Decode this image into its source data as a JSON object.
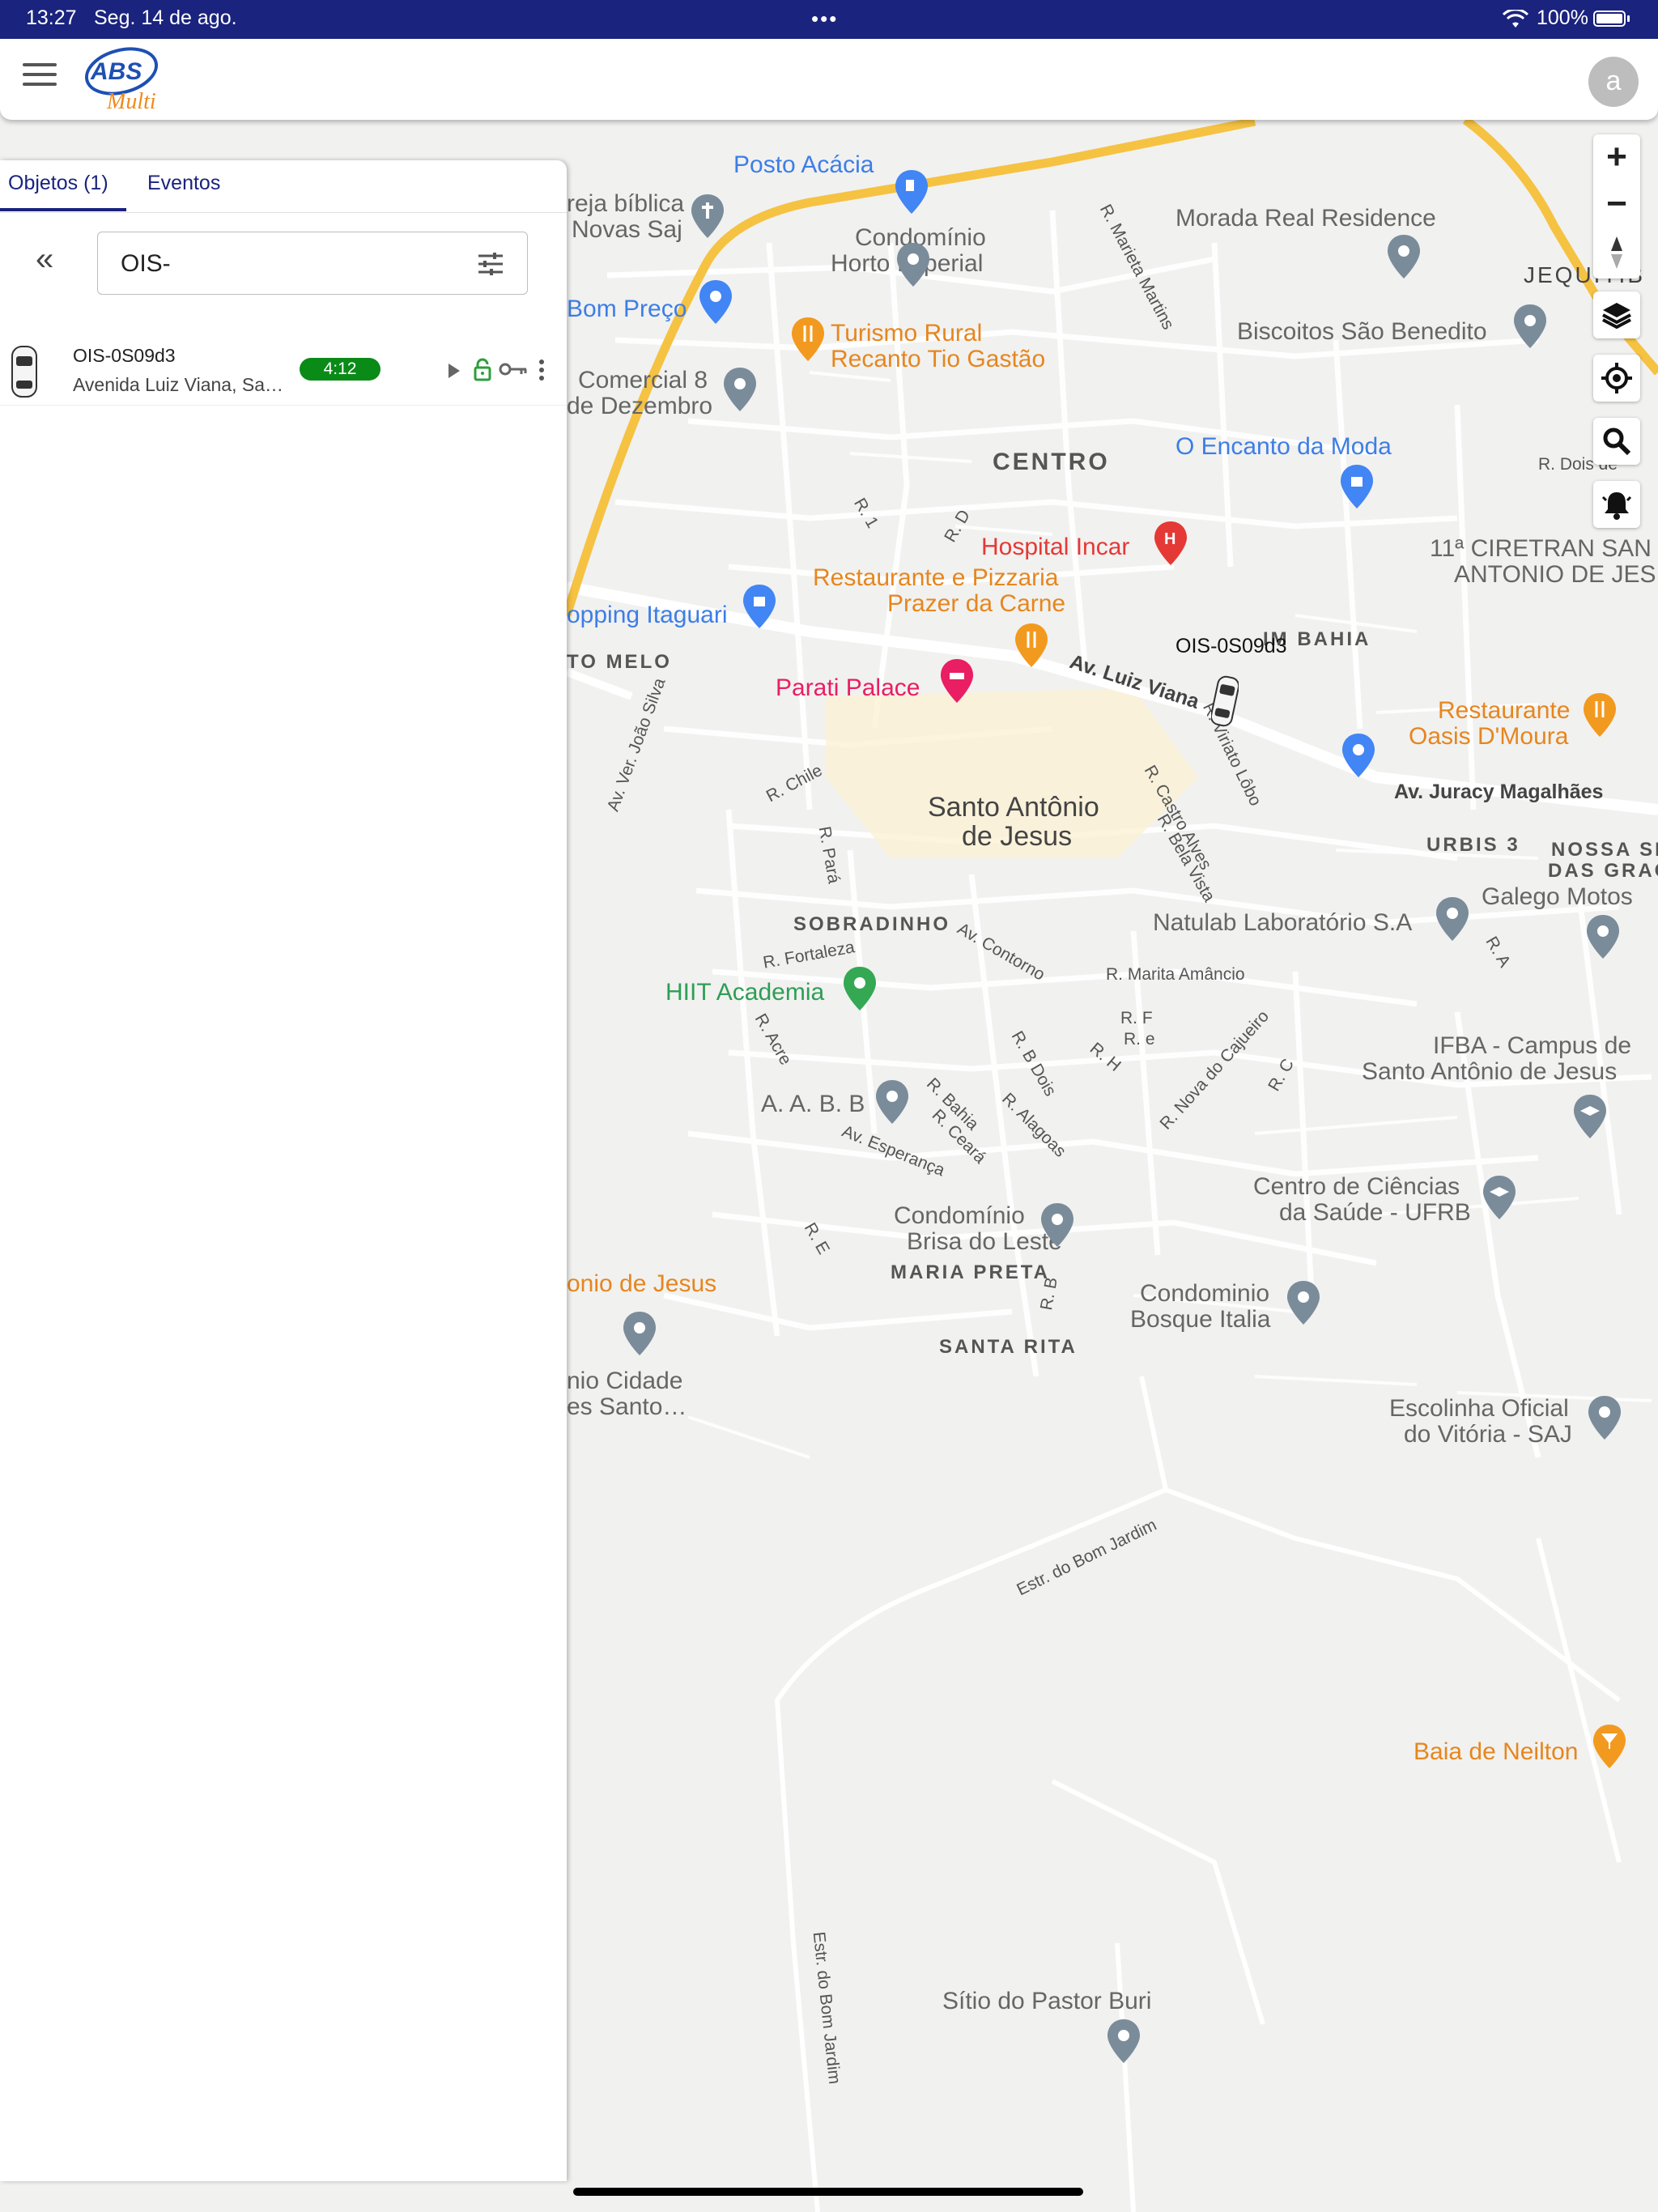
{
  "status_bar": {
    "time": "13:27",
    "date": "Seg. 14 de ago.",
    "dots": "•••",
    "battery": "100%"
  },
  "header": {
    "logo_text_top": "ABS",
    "logo_text_bottom": "Multi",
    "avatar_letter": "a"
  },
  "panel": {
    "tabs": [
      {
        "label": "Objetos (1)",
        "active": true
      },
      {
        "label": "Eventos",
        "active": false
      }
    ],
    "collapse_glyph": "«",
    "search": {
      "value": "OIS-"
    },
    "vehicles": [
      {
        "name": "OIS-0S09d3",
        "address": "Avenida Luiz Viana, Sa…",
        "badge": "4:12",
        "badge_color": "#0a8a17"
      }
    ]
  },
  "map": {
    "vehicle_label": "OIS-0S09d3",
    "controls": {
      "zoom_in": "+",
      "zoom_out": "−",
      "compass": "compass-icon",
      "layers": "layers-icon",
      "locate": "locate-icon",
      "search": "search-icon",
      "alert": "alarm-bell-icon"
    },
    "labels": {
      "posto": "Posto Acácia",
      "igreja_1": "reja bíblica",
      "igreja_2": "Novas Saj",
      "condominio_horto_1": "Condomínio",
      "condominio_horto_2": "Horto Imperial",
      "morada": "Morada Real Residence",
      "jequi": "JEQUITIB",
      "bom_preco": "Bom Preço",
      "turismo_1": "Turismo Rural",
      "turismo_2": "Recanto Tio Gastão",
      "biscoitos": "Biscoitos São Benedito",
      "comercial_1": "Comercial 8",
      "comercial_2": "de Dezembro",
      "centro": "CENTRO",
      "encanto": "O Encanto da Moda",
      "ciretran_1": "11ª CIRETRAN SAN",
      "ciretran_2": "ANTONIO DE JES",
      "hospital": "Hospital Incar",
      "restaurante_1": "Restaurante e Pizzaria",
      "restaurante_2": "Prazer da Carne",
      "shopping": "opping Itaguari",
      "to_melo": "TO MELO",
      "parati": "Parati Palace",
      "bahia": "IM BAHIA",
      "oasis_1": "Restaurante",
      "oasis_2": "Oasis D'Moura",
      "av_luiz": "Av. Luiz Viana",
      "av_juracy": "Av. Juracy Magalhães",
      "santo_1": "Santo Antônio",
      "santo_2": "de Jesus",
      "urbis": "URBIS 3",
      "nossa_1": "NOSSA SR",
      "nossa_2": "DAS GRAC",
      "galego": "Galego Motos",
      "natulab": "Natulab Laboratório S.A",
      "sobradinho": "SOBRADINHO",
      "hiit": "HIIT Academia",
      "marita": "R. Marita Amâncio",
      "ifba_1": "IFBA - Campus de",
      "ifba_2": "Santo Antônio de Jesus",
      "aabb": "A. A. B. B",
      "ufrb_1": "Centro de Ciências",
      "ufrb_2": "da Saúde - UFRB",
      "brisa_1": "Condomínio",
      "brisa_2": "Brisa do Leste",
      "maria_preta": "MARIA PRETA",
      "onio": "onio de Jesus",
      "bosque_1": "Condominio",
      "bosque_2": "Bosque Italia",
      "santa_rita": "SANTA RITA",
      "cidade_1": "nio Cidade",
      "cidade_2": "es Santo…",
      "escolinha_1": "Escolinha Oficial",
      "escolinha_2": "do Vitória - SAJ",
      "estr_bom_jardim": "Estr. do Bom Jardim",
      "baia": "Baia de Neilton",
      "estr_bom_jardim_2": "Estr. do Bom Jardim",
      "sitio": "Sítio do Pastor Buri",
      "r_chile": "R. Chile",
      "r_para": "R. Pará",
      "r_fortaleza": "R. Fortaleza",
      "av_contorno": "Av. Contorno",
      "r_castro": "R. Castro Alves",
      "r_bela": "R. Bela Vista",
      "r_viriato": "R. Viriato Lôbo",
      "av_ver": "Av. Ver. João Silva",
      "r_acre": "R. Acre",
      "r_bahia": "R. Bahia",
      "r_ceara": "R. Ceará",
      "r_alagoas": "R. Alagoas",
      "av_esperanca": "Av. Esperança",
      "r_cajueiro": "R. Nova do Cajueiro",
      "r_bdois": "R. B Dois",
      "r_marieta": "R. Marieta Martins",
      "r_dois": "R. Dois de",
      "r_1": "R. 1",
      "r_d": "R. D",
      "r_f": "R. F",
      "r_e": "R. e",
      "r_h": "R. H",
      "r_c": "R. C",
      "r_a": "R. A",
      "r_b": "R. B",
      "r_ee": "R. E"
    }
  },
  "colors": {
    "status_bar": "#1a237e",
    "accent": "#1a237e",
    "badge_green": "#0a8a17",
    "major_road": "#f5c242"
  }
}
